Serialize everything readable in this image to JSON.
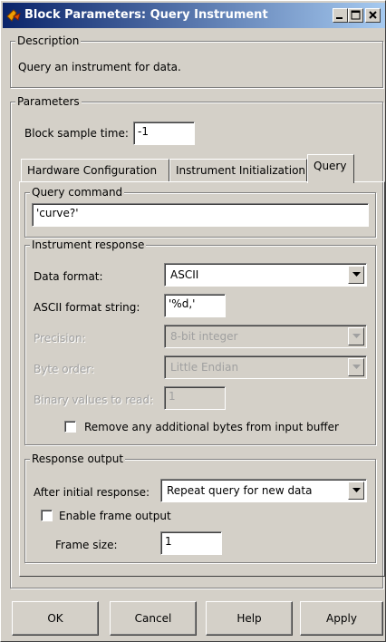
{
  "window": {
    "title": "Block Parameters: Query Instrument",
    "icon": "simulink-block-icon",
    "controls": [
      "minimize",
      "maximize",
      "close"
    ]
  },
  "description": {
    "legend": "Description",
    "text": "Query an instrument for data."
  },
  "parameters": {
    "legend": "Parameters",
    "sample_time_label": "Block sample time:",
    "sample_time_value": "-1"
  },
  "tabs": [
    {
      "label": "Hardware Configuration",
      "active": false
    },
    {
      "label": "Instrument Initialization",
      "active": false
    },
    {
      "label": "Query",
      "active": true
    }
  ],
  "query_command": {
    "legend": "Query command",
    "value": "'curve?'"
  },
  "instrument_response": {
    "legend": "Instrument response",
    "data_format_label": "Data format:",
    "data_format_value": "ASCII",
    "ascii_format_label": "ASCII format string:",
    "ascii_format_value": "'%d,'",
    "precision_label": "Precision:",
    "precision_value": "8-bit integer",
    "byte_order_label": "Byte order:",
    "byte_order_value": "Little Endian",
    "binary_values_label": "Binary values to read:",
    "binary_values_value": "1",
    "remove_bytes_label": "Remove any additional bytes from input buffer",
    "remove_bytes_checked": false
  },
  "response_output": {
    "legend": "Response output",
    "after_initial_label": "After initial response:",
    "after_initial_value": "Repeat query for new data",
    "enable_frame_label": "Enable frame output",
    "enable_frame_checked": false,
    "frame_size_label": "Frame size:",
    "frame_size_value": "1"
  },
  "buttons": {
    "ok": "OK",
    "cancel": "Cancel",
    "help": "Help",
    "apply": "Apply"
  }
}
